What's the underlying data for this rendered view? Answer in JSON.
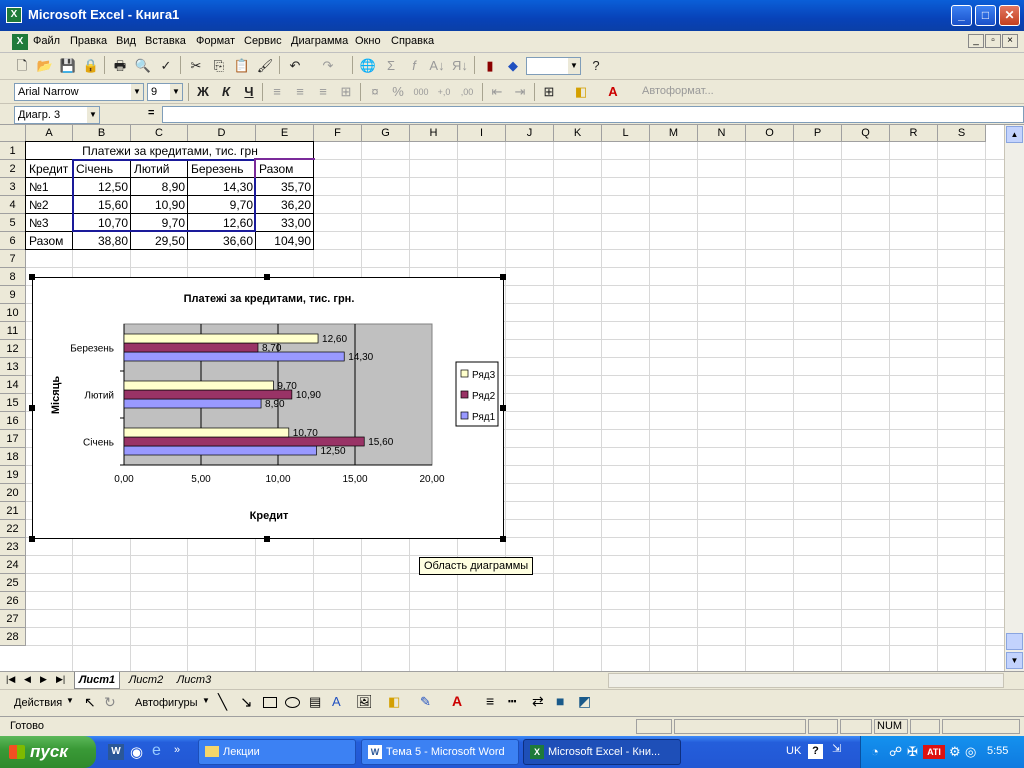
{
  "window": {
    "title": "Microsoft Excel - Книга1"
  },
  "menu": [
    "Файл",
    "Правка",
    "Вид",
    "Вставка",
    "Формат",
    "Сервис",
    "Диаграмма",
    "Окно",
    "Справка"
  ],
  "formatting": {
    "font": "Arial Narrow",
    "size": "9",
    "bold": "Ж",
    "italic": "К",
    "underline": "Ч",
    "autoformat": "Автоформат..."
  },
  "formula_bar": {
    "name_box": "Диагр. 3",
    "equals": "="
  },
  "columns": [
    "A",
    "B",
    "C",
    "D",
    "E",
    "F",
    "G",
    "H",
    "I",
    "J",
    "K",
    "L",
    "M",
    "N",
    "O",
    "P",
    "Q",
    "R",
    "S"
  ],
  "rows": [
    "1",
    "2",
    "3",
    "4",
    "5",
    "6",
    "7",
    "8",
    "9",
    "10",
    "11",
    "12",
    "13",
    "14",
    "15",
    "16",
    "17",
    "18",
    "19",
    "20",
    "21",
    "22",
    "23",
    "24",
    "25",
    "26",
    "27",
    "28"
  ],
  "sheet": {
    "title": "Платежи за кредитами, тис. грн",
    "header": [
      "Кредит",
      "Січень",
      "Лютий",
      "Березень",
      "Разом"
    ],
    "data": [
      [
        "№1",
        "12,50",
        "8,90",
        "14,30",
        "35,70"
      ],
      [
        "№2",
        "15,60",
        "10,90",
        "9,70",
        "36,20"
      ],
      [
        "№3",
        "10,70",
        "9,70",
        "12,60",
        "33,00"
      ],
      [
        "Разом",
        "38,80",
        "29,50",
        "36,60",
        "104,90"
      ]
    ]
  },
  "chart_data": {
    "type": "bar",
    "orientation": "horizontal",
    "title": "Платежі за кредитами, тис. грн.",
    "xlabel": "Кредит",
    "ylabel": "Місяць",
    "categories": [
      "Січень",
      "Лютий",
      "Березень"
    ],
    "series": [
      {
        "name": "Ряд1",
        "values": [
          12.5,
          8.9,
          14.3
        ],
        "labels": [
          "12,50",
          "8,90",
          "14,30"
        ],
        "color": "#9999ff"
      },
      {
        "name": "Ряд2",
        "values": [
          15.6,
          10.9,
          8.7
        ],
        "labels": [
          "15,60",
          "10,90",
          "8,70"
        ],
        "color": "#993366"
      },
      {
        "name": "Ряд3",
        "values": [
          10.7,
          9.7,
          12.6
        ],
        "labels": [
          "10,70",
          "9,70",
          "12,60"
        ],
        "color": "#ffffcc"
      }
    ],
    "xlim": [
      0,
      20
    ],
    "xticks": [
      "0,00",
      "5,00",
      "10,00",
      "15,00",
      "20,00"
    ],
    "plot_background": "#c0c0c0",
    "grid": true,
    "legend": "right"
  },
  "tooltip": "Область диаграммы",
  "sheet_tabs": [
    "Лист1",
    "Лист2",
    "Лист3"
  ],
  "drawing": {
    "actions": "Действия",
    "autoshapes": "Автофигуры"
  },
  "status": {
    "ready": "Готово",
    "num": "NUM"
  },
  "taskbar": {
    "start": "пуск",
    "tasks": [
      "Лекции",
      "Тема 5 - Microsoft Word",
      "Microsoft Excel - Кни..."
    ],
    "lang": "UK",
    "clock": "5:55"
  }
}
